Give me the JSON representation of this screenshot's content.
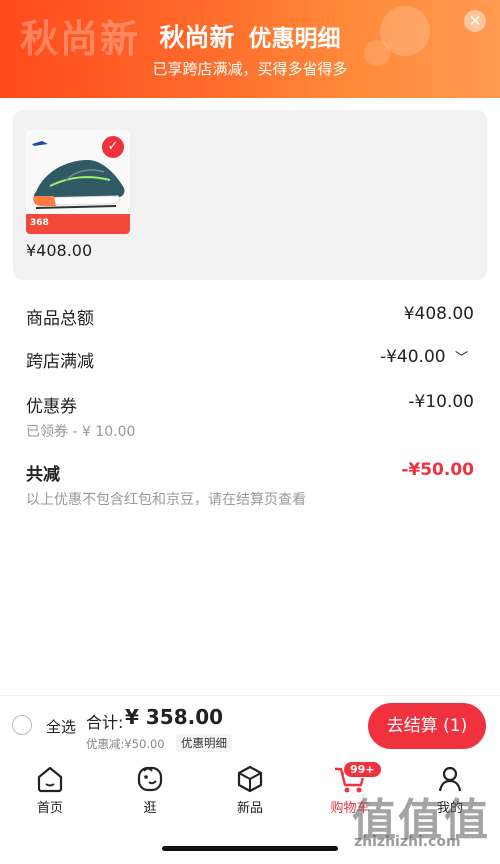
{
  "header": {
    "watermark": "秋尚新",
    "brand": "秋尚新",
    "title": "优惠明细",
    "subtitle": "已享跨店满减，买得多省得多"
  },
  "product": {
    "thumb_tag": "368",
    "price": "¥408.00"
  },
  "summary": {
    "goods_total_label": "商品总额",
    "goods_total_value": "¥408.00",
    "cross_store_label": "跨店满减",
    "cross_store_value": "-¥40.00",
    "coupon_label": "优惠券",
    "coupon_value": "-¥10.00",
    "coupon_note": "已领券 - ¥ 10.00",
    "total_reduce_label": "共减",
    "total_reduce_value": "-¥50.00",
    "disclaimer": "以上优惠不包含红包和京豆，请在结算页查看"
  },
  "checkout": {
    "select_all": "全选",
    "total_label": "合计:",
    "total_value": "¥ 358.00",
    "discount_label": "优惠减:¥50.00",
    "discount_detail": "优惠明细",
    "pay_button": "去结算 (1)"
  },
  "tabs": [
    {
      "label": "首页",
      "icon": "home-icon"
    },
    {
      "label": "逛",
      "icon": "browse-icon"
    },
    {
      "label": "新品",
      "icon": "box-icon"
    },
    {
      "label": "购物车",
      "icon": "cart-icon",
      "badge": "99+"
    },
    {
      "label": "我的",
      "icon": "user-icon"
    }
  ],
  "watermark": {
    "text": "值值值",
    "url": "zhizhizhi.com"
  },
  "colors": {
    "accent": "#f0313e",
    "header_start": "#ff4a1c",
    "header_end": "#ff9a50"
  }
}
